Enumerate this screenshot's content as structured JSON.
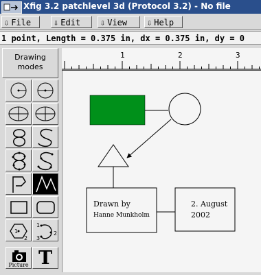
{
  "window": {
    "title": "Xfig 3.2 patchlevel 3d (Protocol 3.2) - No file"
  },
  "menu": {
    "items": [
      {
        "label": "File",
        "icon": "down-arrow-icon"
      },
      {
        "label": "Edit",
        "icon": "down-arrow-icon"
      },
      {
        "label": "View",
        "icon": "down-arrow-icon"
      },
      {
        "label": "Help",
        "icon": "down-arrow-icon"
      }
    ]
  },
  "status_bar": {
    "message": "1 point, Length = 0.375 in, dx = 0.375 in, dy = 0"
  },
  "drawing_modes": {
    "label": "Drawing modes",
    "tools": [
      {
        "name": "circle-radius-tool",
        "icon": "circle-radius-icon"
      },
      {
        "name": "circle-diameter-tool",
        "icon": "circle-diameter-icon"
      },
      {
        "name": "ellipse-radius-tool",
        "icon": "ellipse-radius-icon"
      },
      {
        "name": "ellipse-diameter-tool",
        "icon": "ellipse-diameter-icon"
      },
      {
        "name": "closed-approx-spline-tool",
        "icon": "closed-spline-icon"
      },
      {
        "name": "approx-spline-tool",
        "icon": "open-spline-icon"
      },
      {
        "name": "closed-interp-spline-tool",
        "icon": "closed-interp-spline-icon"
      },
      {
        "name": "interp-spline-tool",
        "icon": "interp-spline-icon"
      },
      {
        "name": "polygon-tool",
        "icon": "polygon-icon"
      },
      {
        "name": "polyline-tool",
        "icon": "polyline-icon",
        "active": true
      },
      {
        "name": "rectangle-tool",
        "icon": "rectangle-icon"
      },
      {
        "name": "rounded-rectangle-tool",
        "icon": "rounded-rectangle-icon"
      },
      {
        "name": "regular-polygon-tool",
        "icon": "regular-polygon-icon"
      },
      {
        "name": "arc-tool",
        "icon": "arc-icon"
      },
      {
        "name": "picture-tool",
        "icon": "camera-icon",
        "label": "Picture"
      },
      {
        "name": "text-tool",
        "icon": "text-t-icon",
        "label": "T"
      }
    ],
    "arc_labels": [
      "1",
      "2",
      "3"
    ],
    "polygon_labels": [
      "1",
      "2"
    ]
  },
  "ruler": {
    "ticks": [
      "1",
      "2",
      "3"
    ]
  },
  "drawing": {
    "text_left_line1": "Drawn by",
    "text_left_line2": "Hanne Munkholm",
    "text_right_line1": "2. August",
    "text_right_line2": "2002",
    "fill_color": "#00901a"
  }
}
